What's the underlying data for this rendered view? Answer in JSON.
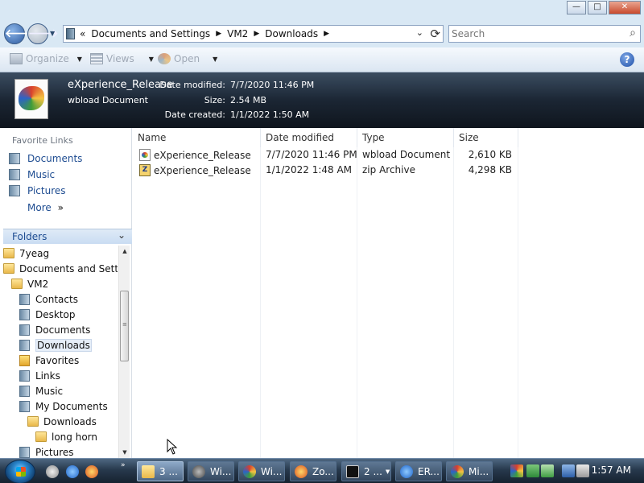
{
  "window": {
    "minimize_glyph": "—",
    "maximize_glyph": "□",
    "close_glyph": "✕"
  },
  "address": {
    "overflow_glyph": "«",
    "crumbs": [
      "Documents and Settings",
      "VM2",
      "Downloads"
    ],
    "search_placeholder": "Search"
  },
  "toolbar": {
    "organize_label": "Organize",
    "views_label": "Views",
    "open_label": "Open",
    "help_glyph": "?"
  },
  "details": {
    "file_name": "eXperience_Release",
    "file_type": "wbload Document",
    "modified_label": "Date modified:",
    "modified_value": "7/7/2020 11:46 PM",
    "size_label": "Size:",
    "size_value": "2.54 MB",
    "created_label": "Date created:",
    "created_value": "1/1/2022 1:50 AM"
  },
  "favorites": {
    "title": "Favorite Links",
    "items": [
      {
        "label": "Documents"
      },
      {
        "label": "Music"
      },
      {
        "label": "Pictures"
      }
    ],
    "more_label": "More",
    "more_glyph": "»"
  },
  "folders": {
    "header": "Folders",
    "chevron": "⌄",
    "tree": [
      {
        "label": "7yeag"
      },
      {
        "label": "Documents and Settings"
      },
      {
        "label": "VM2"
      },
      {
        "label": "Contacts"
      },
      {
        "label": "Desktop"
      },
      {
        "label": "Documents"
      },
      {
        "label": "Downloads"
      },
      {
        "label": "Favorites"
      },
      {
        "label": "Links"
      },
      {
        "label": "Music"
      },
      {
        "label": "My Documents"
      },
      {
        "label": "Downloads"
      },
      {
        "label": "long horn"
      },
      {
        "label": "Pictures"
      }
    ]
  },
  "filelist": {
    "columns": [
      "Name",
      "Date modified",
      "Type",
      "Size"
    ],
    "rows": [
      {
        "name": "eXperience_Release",
        "modified": "7/7/2020 11:46 PM",
        "type": "wbload Document",
        "size": "2,610 KB"
      },
      {
        "name": "eXperience_Release",
        "modified": "1/1/2022 1:48 AM",
        "type": "zip Archive",
        "size": "4,298 KB"
      }
    ]
  },
  "taskbar": {
    "quicklaunch_more": "»",
    "tasks": [
      {
        "label": "3 ..."
      },
      {
        "label": "Wi..."
      },
      {
        "label": "Wi..."
      },
      {
        "label": "Zo..."
      },
      {
        "label": "2 ..."
      },
      {
        "label": "ER..."
      },
      {
        "label": "Mi..."
      }
    ],
    "clock": "1:57 AM"
  }
}
